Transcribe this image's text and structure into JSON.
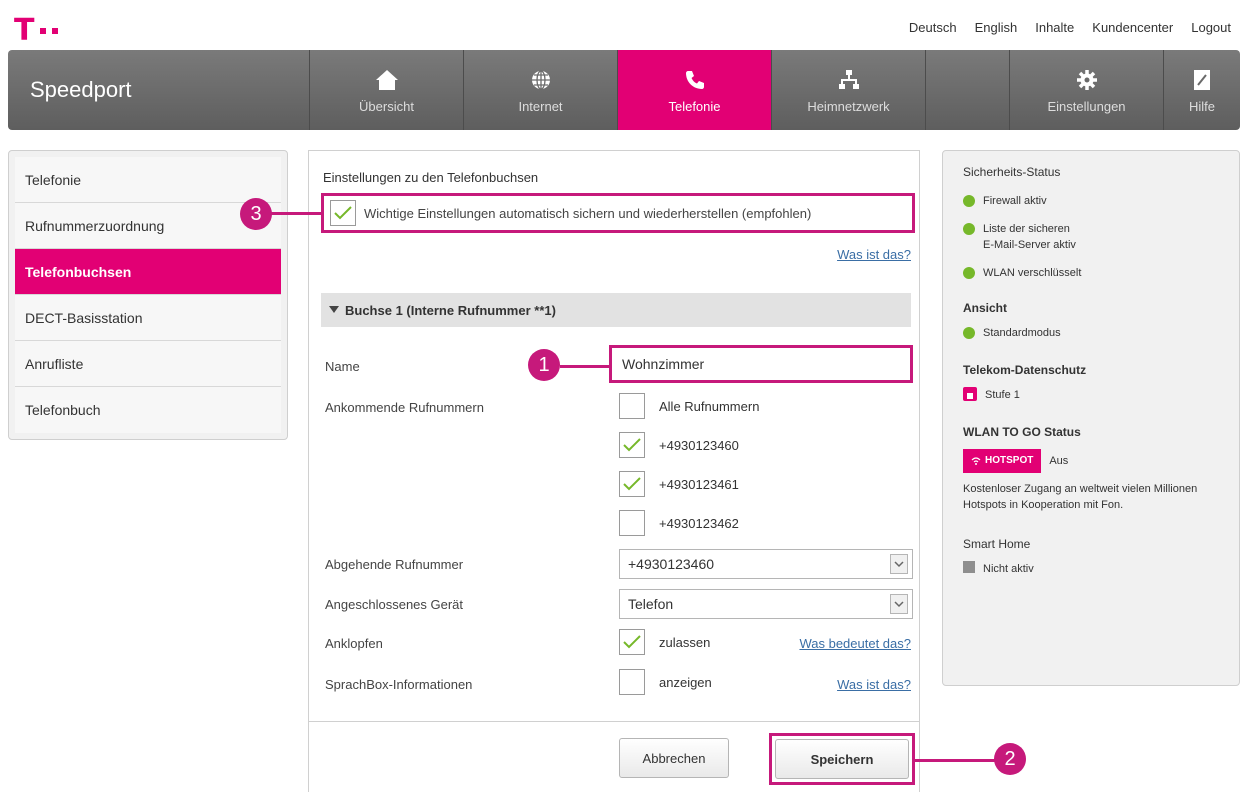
{
  "top_links": [
    "Deutsch",
    "English",
    "Inhalte",
    "Kundencenter",
    "Logout"
  ],
  "brand": "Speedport",
  "nav": {
    "items": [
      {
        "label": "Übersicht",
        "icon": "home-icon"
      },
      {
        "label": "Internet",
        "icon": "globe-icon"
      },
      {
        "label": "Telefonie",
        "icon": "phone-icon",
        "active": true
      },
      {
        "label": "Heimnetzwerk",
        "icon": "network-icon"
      },
      {
        "label": "Einstellungen",
        "icon": "gear-icon"
      },
      {
        "label": "Hilfe",
        "icon": "help-icon"
      }
    ]
  },
  "sidebar": {
    "items": [
      {
        "label": "Telefonie"
      },
      {
        "label": "Rufnummerzuordnung"
      },
      {
        "label": "Telefonbuchsen",
        "active": true
      },
      {
        "label": "DECT-Basisstation"
      },
      {
        "label": "Anrufliste"
      },
      {
        "label": "Telefonbuch"
      }
    ]
  },
  "main": {
    "title": "Einstellungen zu den Telefonbuchsen",
    "autosave_label": "Wichtige Einstellungen automatisch sichern und wiederherstellen (empfohlen)",
    "autosave_checked": true,
    "help_link": "Was ist das?",
    "section_title": "Buchse 1 (Interne Rufnummer **1)",
    "name_label": "Name",
    "name_value": "Wohnzimmer",
    "incoming_label": "Ankommende Rufnummern",
    "incoming": [
      {
        "label": "Alle Rufnummern",
        "checked": false
      },
      {
        "label": "+4930123460",
        "checked": true
      },
      {
        "label": "+4930123461",
        "checked": true
      },
      {
        "label": "+4930123462",
        "checked": false
      }
    ],
    "outgoing_label": "Abgehende Rufnummer",
    "outgoing_value": "+4930123460",
    "device_label": "Angeschlossenes Gerät",
    "device_value": "Telefon",
    "callwaiting_label": "Anklopfen",
    "callwaiting_option": "zulassen",
    "callwaiting_checked": true,
    "callwaiting_link": "Was bedeutet das?",
    "voicebox_label": "SprachBox-Informationen",
    "voicebox_option": "anzeigen",
    "voicebox_checked": false,
    "voicebox_link": "Was ist das?",
    "cancel_label": "Abbrechen",
    "save_label": "Speichern"
  },
  "right_panel": {
    "security_title": "Sicherheits-Status",
    "security_items": [
      "Firewall aktiv",
      "Liste der sicheren",
      "E-Mail-Server aktiv",
      "WLAN verschlüsselt"
    ],
    "view_title": "Ansicht",
    "view_item": "Standardmodus",
    "privacy_title": "Telekom-Datenschutz",
    "privacy_item": "Stufe 1",
    "wlan_title": "WLAN TO GO Status",
    "hotspot_label": "HOTSPOT",
    "hotspot_state": "Aus",
    "wlan_text": "Kostenloser Zugang an weltweit vielen Millionen Hotspots in Kooperation mit Fon.",
    "smarthome_title": "Smart Home",
    "smarthome_item": "Nicht aktiv"
  },
  "callouts": [
    "1",
    "2",
    "3"
  ],
  "colors": {
    "brand": "#e20074",
    "highlight": "#c6197b",
    "status_ok": "#76b82a"
  }
}
